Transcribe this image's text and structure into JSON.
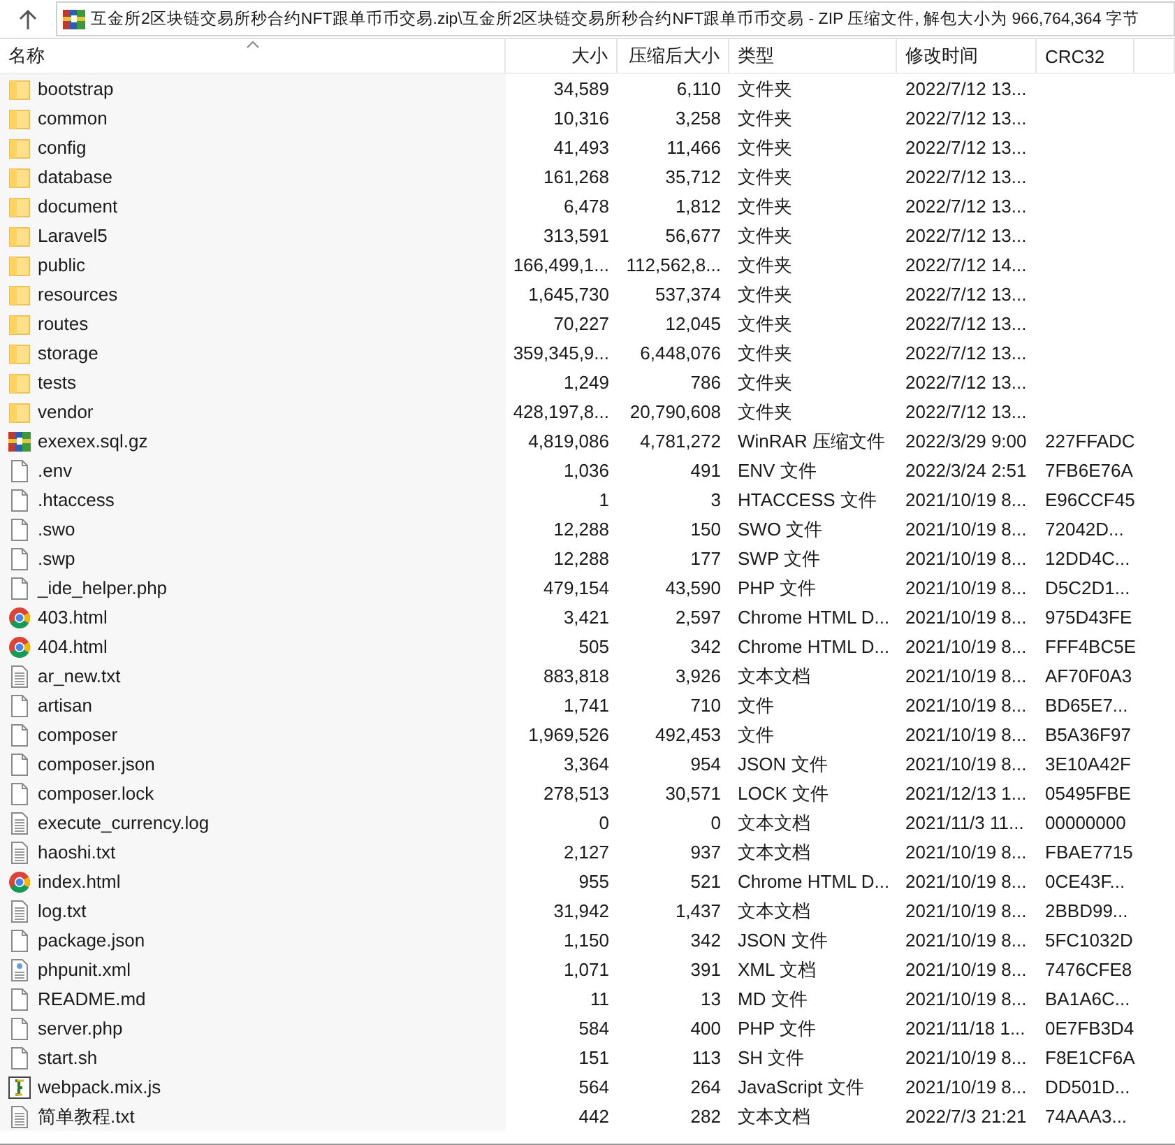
{
  "address_bar": {
    "path": "互金所2区块链交易所秒合约NFT跟单币币交易.zip\\互金所2区块链交易所秒合约NFT跟单币币交易 - ZIP 压缩文件, 解包大小为 966,764,364 字节"
  },
  "table": {
    "columns": [
      {
        "label": "名称",
        "sorted": true
      },
      {
        "label": "大小",
        "sorted": false
      },
      {
        "label": "压缩后大小",
        "sorted": false
      },
      {
        "label": "类型",
        "sorted": false
      },
      {
        "label": "修改时间",
        "sorted": false
      },
      {
        "label": "CRC32",
        "sorted": false
      }
    ],
    "rows": [
      {
        "kind": "folder",
        "name": "bootstrap",
        "size": "34,589",
        "packed": "6,110",
        "type": "文件夹",
        "modified": "2022/7/12 13..."
      },
      {
        "kind": "folder",
        "name": "common",
        "size": "10,316",
        "packed": "3,258",
        "type": "文件夹",
        "modified": "2022/7/12 13..."
      },
      {
        "kind": "folder",
        "name": "config",
        "size": "41,493",
        "packed": "11,466",
        "type": "文件夹",
        "modified": "2022/7/12 13..."
      },
      {
        "kind": "folder",
        "name": "database",
        "size": "161,268",
        "packed": "35,712",
        "type": "文件夹",
        "modified": "2022/7/12 13..."
      },
      {
        "kind": "folder",
        "name": "document",
        "size": "6,478",
        "packed": "1,812",
        "type": "文件夹",
        "modified": "2022/7/12 13..."
      },
      {
        "kind": "folder",
        "name": "Laravel5",
        "size": "313,591",
        "packed": "56,677",
        "type": "文件夹",
        "modified": "2022/7/12 13..."
      },
      {
        "kind": "folder",
        "name": "public",
        "size": "166,499,1...",
        "packed": "112,562,8...",
        "type": "文件夹",
        "modified": "2022/7/12 14..."
      },
      {
        "kind": "folder",
        "name": "resources",
        "size": "1,645,730",
        "packed": "537,374",
        "type": "文件夹",
        "modified": "2022/7/12 13..."
      },
      {
        "kind": "folder",
        "name": "routes",
        "size": "70,227",
        "packed": "12,045",
        "type": "文件夹",
        "modified": "2022/7/12 13..."
      },
      {
        "kind": "folder",
        "name": "storage",
        "size": "359,345,9...",
        "packed": "6,448,076",
        "type": "文件夹",
        "modified": "2022/7/12 13..."
      },
      {
        "kind": "folder",
        "name": "tests",
        "size": "1,249",
        "packed": "786",
        "type": "文件夹",
        "modified": "2022/7/12 13..."
      },
      {
        "kind": "folder",
        "name": "vendor",
        "size": "428,197,8...",
        "packed": "20,790,608",
        "type": "文件夹",
        "modified": "2022/7/12 13..."
      },
      {
        "kind": "archive",
        "name": "exexex.sql.gz",
        "size": "4,819,086",
        "packed": "4,781,272",
        "type": "WinRAR 压缩文件",
        "modified": "2022/3/29 9:00",
        "crc": "227FFADC"
      },
      {
        "kind": "file",
        "name": ".env",
        "size": "1,036",
        "packed": "491",
        "type": "ENV 文件",
        "modified": "2022/3/24 2:51",
        "crc": "7FB6E76A"
      },
      {
        "kind": "file",
        "name": ".htaccess",
        "size": "1",
        "packed": "3",
        "type": "HTACCESS 文件",
        "modified": "2021/10/19 8...",
        "crc": "E96CCF45"
      },
      {
        "kind": "file",
        "name": ".swo",
        "size": "12,288",
        "packed": "150",
        "type": "SWO 文件",
        "modified": "2021/10/19 8...",
        "crc": "72042D..."
      },
      {
        "kind": "file",
        "name": ".swp",
        "size": "12,288",
        "packed": "177",
        "type": "SWP 文件",
        "modified": "2021/10/19 8...",
        "crc": "12DD4C..."
      },
      {
        "kind": "file",
        "name": "_ide_helper.php",
        "size": "479,154",
        "packed": "43,590",
        "type": "PHP 文件",
        "modified": "2021/10/19 8...",
        "crc": "D5C2D1..."
      },
      {
        "kind": "browser",
        "name": "403.html",
        "size": "3,421",
        "packed": "2,597",
        "type": "Chrome HTML D...",
        "modified": "2021/10/19 8...",
        "crc": "975D43FE"
      },
      {
        "kind": "browser",
        "name": "404.html",
        "size": "505",
        "packed": "342",
        "type": "Chrome HTML D...",
        "modified": "2021/10/19 8...",
        "crc": "FFF4BC5E"
      },
      {
        "kind": "text",
        "name": "ar_new.txt",
        "size": "883,818",
        "packed": "3,926",
        "type": "文本文档",
        "modified": "2021/10/19 8...",
        "crc": "AF70F0A3"
      },
      {
        "kind": "file",
        "name": "artisan",
        "size": "1,741",
        "packed": "710",
        "type": "文件",
        "modified": "2021/10/19 8...",
        "crc": "BD65E7..."
      },
      {
        "kind": "file",
        "name": "composer",
        "size": "1,969,526",
        "packed": "492,453",
        "type": "文件",
        "modified": "2021/10/19 8...",
        "crc": "B5A36F97"
      },
      {
        "kind": "file",
        "name": "composer.json",
        "size": "3,364",
        "packed": "954",
        "type": "JSON 文件",
        "modified": "2021/10/19 8...",
        "crc": "3E10A42F"
      },
      {
        "kind": "file",
        "name": "composer.lock",
        "size": "278,513",
        "packed": "30,571",
        "type": "LOCK 文件",
        "modified": "2021/12/13 1...",
        "crc": "05495FBE"
      },
      {
        "kind": "text",
        "name": "execute_currency.log",
        "size": "0",
        "packed": "0",
        "type": "文本文档",
        "modified": "2021/11/3 11...",
        "crc": "00000000"
      },
      {
        "kind": "text",
        "name": "haoshi.txt",
        "size": "2,127",
        "packed": "937",
        "type": "文本文档",
        "modified": "2021/10/19 8...",
        "crc": "FBAE7715"
      },
      {
        "kind": "browser",
        "name": "index.html",
        "size": "955",
        "packed": "521",
        "type": "Chrome HTML D...",
        "modified": "2021/10/19 8...",
        "crc": "0CE43F..."
      },
      {
        "kind": "text",
        "name": "log.txt",
        "size": "31,942",
        "packed": "1,437",
        "type": "文本文档",
        "modified": "2021/10/19 8...",
        "crc": "2BBD99..."
      },
      {
        "kind": "file",
        "name": "package.json",
        "size": "1,150",
        "packed": "342",
        "type": "JSON 文件",
        "modified": "2021/10/19 8...",
        "crc": "5FC1032D"
      },
      {
        "kind": "xml",
        "name": "phpunit.xml",
        "size": "1,071",
        "packed": "391",
        "type": "XML 文档",
        "modified": "2021/10/19 8...",
        "crc": "7476CFE8"
      },
      {
        "kind": "file",
        "name": "README.md",
        "size": "11",
        "packed": "13",
        "type": "MD 文件",
        "modified": "2021/10/19 8...",
        "crc": "BA1A6C..."
      },
      {
        "kind": "file",
        "name": "server.php",
        "size": "584",
        "packed": "400",
        "type": "PHP 文件",
        "modified": "2021/11/18 1...",
        "crc": "0E7FB3D4"
      },
      {
        "kind": "file",
        "name": "start.sh",
        "size": "151",
        "packed": "113",
        "type": "SH 文件",
        "modified": "2021/10/19 8...",
        "crc": "F8E1CF6A"
      },
      {
        "kind": "script",
        "name": "webpack.mix.js",
        "size": "564",
        "packed": "264",
        "type": "JavaScript 文件",
        "modified": "2021/10/19 8...",
        "crc": "DD501D..."
      },
      {
        "kind": "text",
        "name": "简单教程.txt",
        "size": "442",
        "packed": "282",
        "type": "文本文档",
        "modified": "2022/7/3 21:21",
        "crc": "74AAA3..."
      }
    ]
  }
}
